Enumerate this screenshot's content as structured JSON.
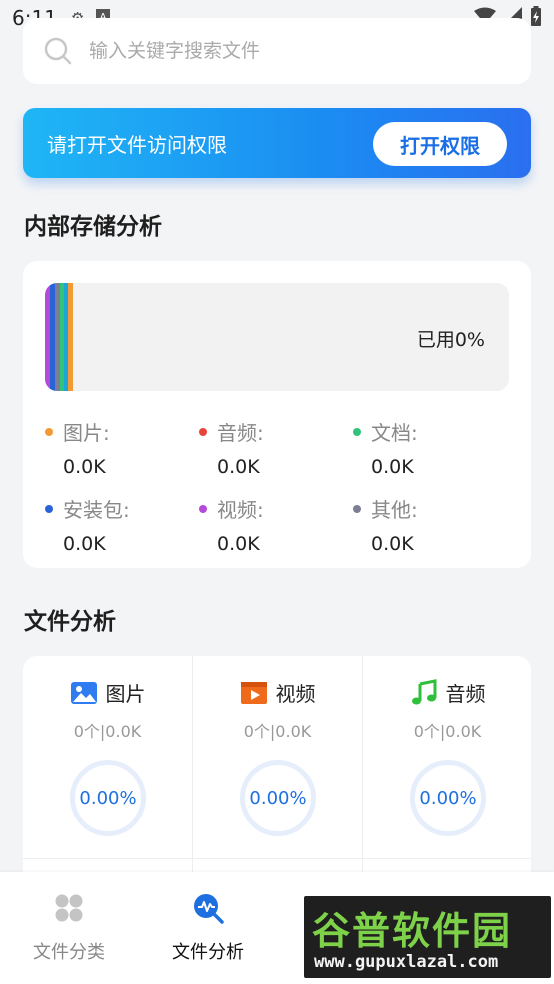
{
  "status_bar": {
    "time": "6:11"
  },
  "search": {
    "placeholder": "输入关键字搜索文件"
  },
  "permission_banner": {
    "text": "请打开文件访问权限",
    "button_label": "打开权限"
  },
  "storage": {
    "title": "内部存储分析",
    "used_label": "已用0%",
    "categories": [
      {
        "label": "图片:",
        "value": "0.0K",
        "color": "#f39a35"
      },
      {
        "label": "音频:",
        "value": "0.0K",
        "color": "#e8443a"
      },
      {
        "label": "文档:",
        "value": "0.0K",
        "color": "#33c27a"
      },
      {
        "label": "安装包:",
        "value": "0.0K",
        "color": "#2a62d8"
      },
      {
        "label": "视频:",
        "value": "0.0K",
        "color": "#b44bd8"
      },
      {
        "label": "其他:",
        "value": "0.0K",
        "color": "#7c7f94"
      }
    ]
  },
  "file_analysis": {
    "title": "文件分析",
    "items": [
      {
        "label": "图片",
        "meta": "0个|0.0K",
        "percent": "0.00%",
        "icon": "image-icon"
      },
      {
        "label": "视频",
        "meta": "0个|0.0K",
        "percent": "0.00%",
        "icon": "video-icon"
      },
      {
        "label": "音频",
        "meta": "0个|0.0K",
        "percent": "0.00%",
        "icon": "music-icon"
      }
    ]
  },
  "bottom_nav": {
    "items": [
      {
        "label": "文件分类",
        "active": false,
        "icon": "grid-icon"
      },
      {
        "label": "文件分析",
        "active": true,
        "icon": "analysis-icon"
      }
    ]
  },
  "watermark": {
    "title": "谷普软件园",
    "url": "www.gupuxlazal.com"
  },
  "colors": {
    "accent": "#1e6fe0",
    "banner_start": "#1fb6f5",
    "banner_end": "#2a6ff0"
  }
}
